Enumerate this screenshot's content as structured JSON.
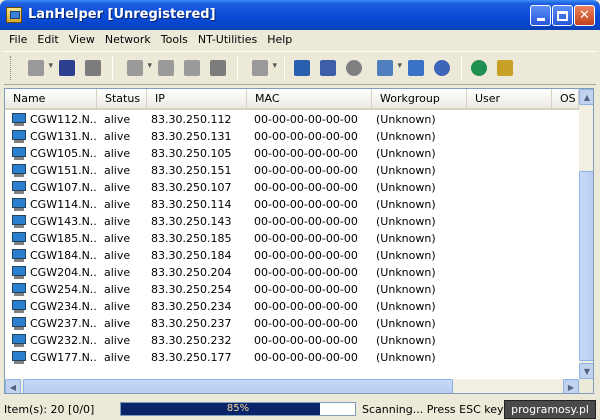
{
  "window": {
    "title": "LanHelper [Unregistered]"
  },
  "menu": [
    "File",
    "Edit",
    "View",
    "Network",
    "Tools",
    "NT-Utilities",
    "Help"
  ],
  "toolbar": {
    "icons": [
      {
        "name": "open-folder-icon",
        "color": "#9a9a9a"
      },
      {
        "name": "save-icon",
        "color": "#2d3f8f"
      },
      {
        "name": "export-icon",
        "color": "#7c7c7c"
      },
      {
        "name": "scan-network-icon",
        "color": "#9a9a9a"
      },
      {
        "name": "add-computer-icon",
        "color": "#9a9a9a"
      },
      {
        "name": "upload-icon",
        "color": "#9a9a9a"
      },
      {
        "name": "send-icon",
        "color": "#7c7c7c"
      },
      {
        "name": "properties-icon",
        "color": "#9a9a9a"
      },
      {
        "name": "wake-lightning-icon",
        "color": "#2a5fb0"
      },
      {
        "name": "disk-icon",
        "color": "#3c5fa8"
      },
      {
        "name": "shutdown-icon",
        "color": "#808080"
      },
      {
        "name": "run-program-icon",
        "color": "#4f7fbf"
      },
      {
        "name": "message-icon",
        "color": "#3a72c8"
      },
      {
        "name": "settings-gears-icon",
        "color": "#3c66b8"
      },
      {
        "name": "refresh-globe-icon",
        "color": "#1f8f4f"
      },
      {
        "name": "register-certificate-icon",
        "color": "#c8a026"
      }
    ]
  },
  "columns": [
    "Name",
    "Status",
    "IP",
    "MAC",
    "Workgroup",
    "User",
    "OS"
  ],
  "rows": [
    {
      "name": "CGW112.N...",
      "status": "alive",
      "ip": "83.30.250.112",
      "mac": "00-00-00-00-00-00",
      "workgroup": "(Unknown)"
    },
    {
      "name": "CGW131.N...",
      "status": "alive",
      "ip": "83.30.250.131",
      "mac": "00-00-00-00-00-00",
      "workgroup": "(Unknown)"
    },
    {
      "name": "CGW105.N...",
      "status": "alive",
      "ip": "83.30.250.105",
      "mac": "00-00-00-00-00-00",
      "workgroup": "(Unknown)"
    },
    {
      "name": "CGW151.N...",
      "status": "alive",
      "ip": "83.30.250.151",
      "mac": "00-00-00-00-00-00",
      "workgroup": "(Unknown)"
    },
    {
      "name": "CGW107.N...",
      "status": "alive",
      "ip": "83.30.250.107",
      "mac": "00-00-00-00-00-00",
      "workgroup": "(Unknown)"
    },
    {
      "name": "CGW114.N...",
      "status": "alive",
      "ip": "83.30.250.114",
      "mac": "00-00-00-00-00-00",
      "workgroup": "(Unknown)"
    },
    {
      "name": "CGW143.N...",
      "status": "alive",
      "ip": "83.30.250.143",
      "mac": "00-00-00-00-00-00",
      "workgroup": "(Unknown)"
    },
    {
      "name": "CGW185.N...",
      "status": "alive",
      "ip": "83.30.250.185",
      "mac": "00-00-00-00-00-00",
      "workgroup": "(Unknown)"
    },
    {
      "name": "CGW184.N...",
      "status": "alive",
      "ip": "83.30.250.184",
      "mac": "00-00-00-00-00-00",
      "workgroup": "(Unknown)"
    },
    {
      "name": "CGW204.N...",
      "status": "alive",
      "ip": "83.30.250.204",
      "mac": "00-00-00-00-00-00",
      "workgroup": "(Unknown)"
    },
    {
      "name": "CGW254.N...",
      "status": "alive",
      "ip": "83.30.250.254",
      "mac": "00-00-00-00-00-00",
      "workgroup": "(Unknown)"
    },
    {
      "name": "CGW234.N...",
      "status": "alive",
      "ip": "83.30.250.234",
      "mac": "00-00-00-00-00-00",
      "workgroup": "(Unknown)"
    },
    {
      "name": "CGW237.N...",
      "status": "alive",
      "ip": "83.30.250.237",
      "mac": "00-00-00-00-00-00",
      "workgroup": "(Unknown)"
    },
    {
      "name": "CGW232.N...",
      "status": "alive",
      "ip": "83.30.250.232",
      "mac": "00-00-00-00-00-00",
      "workgroup": "(Unknown)"
    },
    {
      "name": "CGW177.N...",
      "status": "alive",
      "ip": "83.30.250.177",
      "mac": "00-00-00-00-00-00",
      "workgroup": "(Unknown)"
    }
  ],
  "statusbar": {
    "items": "Item(s): 20 [0/0]",
    "progress_text": "85%",
    "progress_value": 0.85,
    "scanning": "Scanning... Press ESC key to stop",
    "watermark": "programosy.pl"
  }
}
